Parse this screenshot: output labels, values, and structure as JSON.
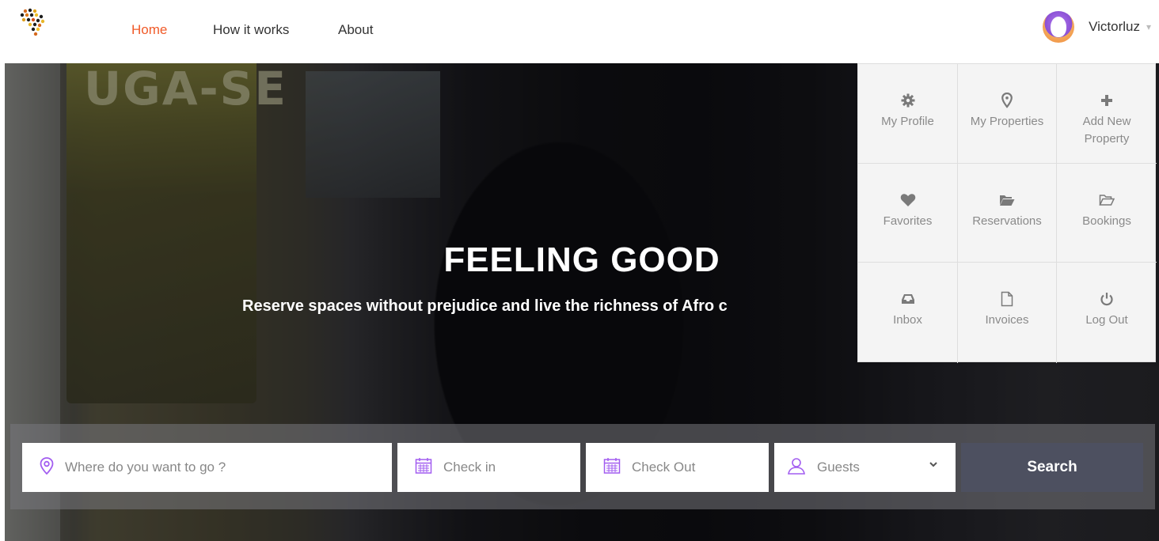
{
  "header": {
    "nav": {
      "home": "Home",
      "how_it_works": "How it works",
      "about": "About"
    },
    "user": {
      "name": "Victorluz"
    },
    "accent_color": "#f05a28"
  },
  "hero": {
    "title": "FEELING GOOD",
    "subtitle": "Reserve spaces without prejudice and live the richness of Afro c",
    "sign_text": "UGA-SE"
  },
  "search": {
    "where_placeholder": "Where do you want to go ?",
    "checkin_placeholder": "Check in",
    "checkout_placeholder": "Check Out",
    "guests_placeholder": "Guests",
    "search_label": "Search",
    "icon_color": "#a25df0",
    "button_color": "#4d5060"
  },
  "user_menu": {
    "items": [
      {
        "label": "My Profile",
        "icon": "gear-icon"
      },
      {
        "label": "My Properties",
        "icon": "map-pin-icon"
      },
      {
        "label": "Add New Property",
        "icon": "plus-icon"
      },
      {
        "label": "Favorites",
        "icon": "heart-icon"
      },
      {
        "label": "Reservations",
        "icon": "folder-open-icon"
      },
      {
        "label": "Bookings",
        "icon": "folder-outline-icon"
      },
      {
        "label": "Inbox",
        "icon": "inbox-icon"
      },
      {
        "label": "Invoices",
        "icon": "file-icon"
      },
      {
        "label": "Log Out",
        "icon": "power-icon"
      }
    ]
  }
}
